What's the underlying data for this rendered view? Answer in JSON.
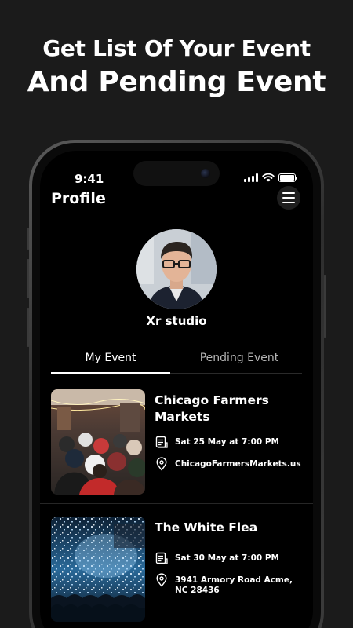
{
  "headline": {
    "line1": "Get List Of Your Event",
    "line2": "And Pending Event"
  },
  "status_bar": {
    "time": "9:41"
  },
  "header": {
    "title": "Profile"
  },
  "profile": {
    "name": "Xr studio"
  },
  "tabs": [
    {
      "label": "My Event",
      "active": true
    },
    {
      "label": "Pending Event",
      "active": false
    }
  ],
  "events": [
    {
      "title": "Chicago Farmers Markets",
      "datetime": "Sat 25 May at 7:00 PM",
      "location": "ChicagoFarmersMarkets.us",
      "image": "crowd-market-photo"
    },
    {
      "title": "The White Flea",
      "datetime": "Sat 30 May at 7:00 PM",
      "location": "3941 Armory Road Acme, NC 28436",
      "image": "concert-confetti-photo"
    }
  ],
  "colors": {
    "background": "#1b1b1b",
    "screen": "#000000",
    "text_primary": "#ffffff",
    "text_muted": "#b5b5b5"
  }
}
